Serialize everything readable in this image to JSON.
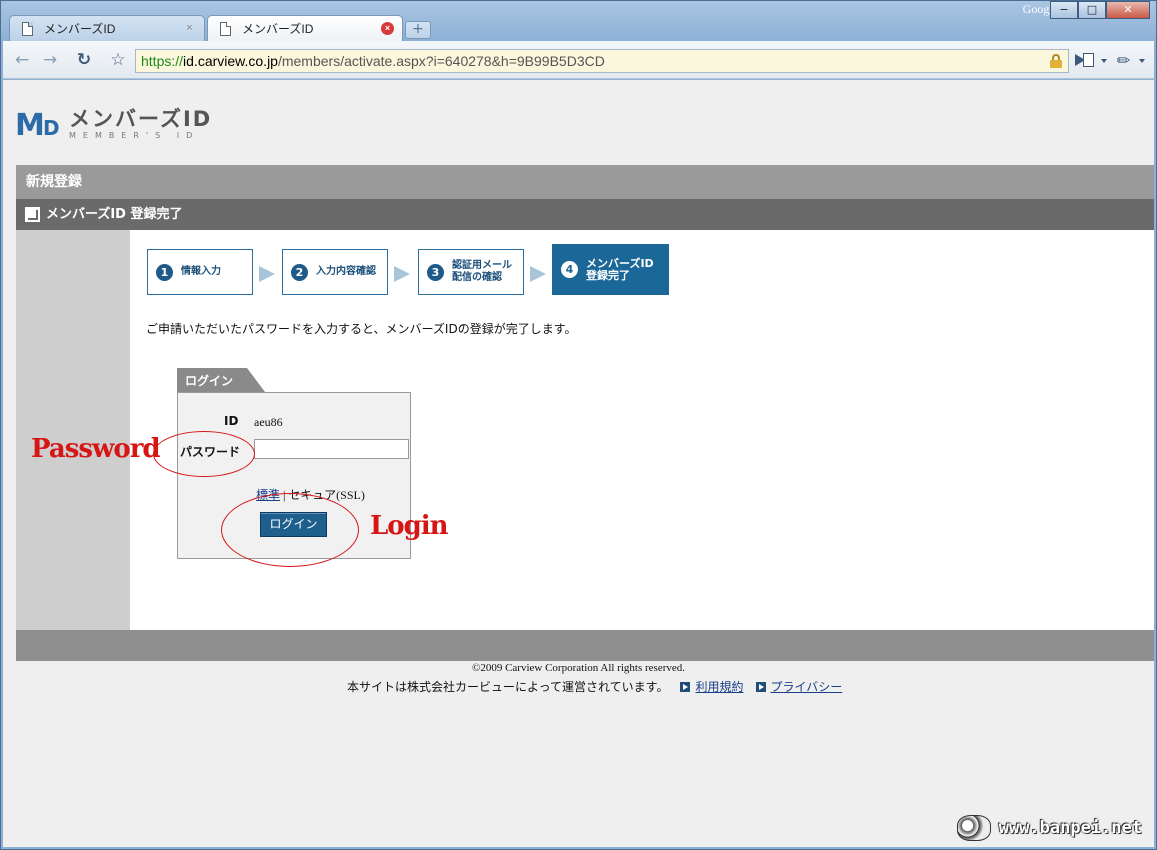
{
  "browser": {
    "tabs": [
      {
        "label": "メンバーズID",
        "active": false
      },
      {
        "label": "メンバーズID",
        "active": true
      }
    ],
    "google_label": "Google",
    "url": {
      "scheme": "https://",
      "host": "id.carview.co.jp",
      "path": "/members/activate.aspx?i=640278&h=9B99B5D3CD"
    }
  },
  "logo": {
    "title": "メンバーズID",
    "subtitle": "MEMBER'S ID"
  },
  "header": {
    "section": "新規登録",
    "subsection": "メンバーズID 登録完了"
  },
  "steps": [
    {
      "num": "1",
      "label": "情報入力"
    },
    {
      "num": "2",
      "label": "入力内容確認"
    },
    {
      "num": "3",
      "label_line1": "認証用メール",
      "label_line2": "配信の確認"
    },
    {
      "num": "4",
      "label_line1": "メンバーズID",
      "label_line2": "登録完了"
    }
  ],
  "intro_text": "ご申請いただいたパスワードを入力すると、メンバーズIDの登録が完了します。",
  "login": {
    "tab_label": "ログイン",
    "id_label": "ID",
    "id_value": "aeu86",
    "password_label": "パスワード",
    "mode_standard": "標準",
    "mode_separator": " | ",
    "mode_secure": "セキュア(SSL)",
    "button_label": "ログイン"
  },
  "annotations": {
    "password": "Password",
    "login": "Login"
  },
  "footer": {
    "copyright": "©2009 Carview Corporation All rights reserved.",
    "operator": "本サイトは株式会社カービューによって運営されています。",
    "terms_link": "利用規約",
    "privacy_link": "プライバシー"
  },
  "watermark": "www.banpei.net",
  "colors": {
    "brand_blue": "#1b6797",
    "annotation_red": "#d61515"
  }
}
